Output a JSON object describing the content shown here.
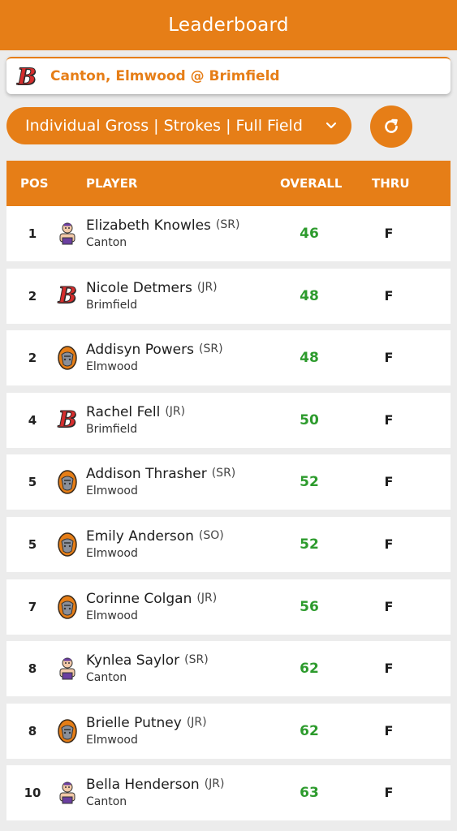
{
  "header": {
    "title": "Leaderboard"
  },
  "match": {
    "title": "Canton, Elmwood @ Brimfield",
    "logo_letter": "B"
  },
  "filter": {
    "selected": "Individual Gross | Strokes | Full Field"
  },
  "colors": {
    "accent": "#e67e17",
    "score_green": "#2d9b2d",
    "brimfield_red": "#d62d2d"
  },
  "table": {
    "columns": {
      "pos": "POS",
      "player": "PLAYER",
      "overall": "OVERALL",
      "thru": "THRU"
    },
    "rows": [
      {
        "pos": "1",
        "name": "Elizabeth Knowles",
        "class": "(SR)",
        "team": "Canton",
        "logo": "canton-logo-icon",
        "overall": "46",
        "thru": "F"
      },
      {
        "pos": "2",
        "name": "Nicole Detmers",
        "class": "(JR)",
        "team": "Brimfield",
        "logo": "brimfield-logo-icon",
        "overall": "48",
        "thru": "F"
      },
      {
        "pos": "2",
        "name": "Addisyn Powers",
        "class": "(SR)",
        "team": "Elmwood",
        "logo": "elmwood-logo-icon",
        "overall": "48",
        "thru": "F"
      },
      {
        "pos": "4",
        "name": "Rachel Fell",
        "class": "(JR)",
        "team": "Brimfield",
        "logo": "brimfield-logo-icon",
        "overall": "50",
        "thru": "F"
      },
      {
        "pos": "5",
        "name": "Addison Thrasher",
        "class": "(SR)",
        "team": "Elmwood",
        "logo": "elmwood-logo-icon",
        "overall": "52",
        "thru": "F"
      },
      {
        "pos": "5",
        "name": "Emily Anderson",
        "class": "(SO)",
        "team": "Elmwood",
        "logo": "elmwood-logo-icon",
        "overall": "52",
        "thru": "F"
      },
      {
        "pos": "7",
        "name": "Corinne Colgan",
        "class": "(JR)",
        "team": "Elmwood",
        "logo": "elmwood-logo-icon",
        "overall": "56",
        "thru": "F"
      },
      {
        "pos": "8",
        "name": "Kynlea Saylor",
        "class": "(SR)",
        "team": "Canton",
        "logo": "canton-logo-icon",
        "overall": "62",
        "thru": "F"
      },
      {
        "pos": "8",
        "name": "Brielle Putney",
        "class": "(JR)",
        "team": "Elmwood",
        "logo": "elmwood-logo-icon",
        "overall": "62",
        "thru": "F"
      },
      {
        "pos": "10",
        "name": "Bella Henderson",
        "class": "(JR)",
        "team": "Canton",
        "logo": "canton-logo-icon",
        "overall": "63",
        "thru": "F"
      }
    ]
  }
}
